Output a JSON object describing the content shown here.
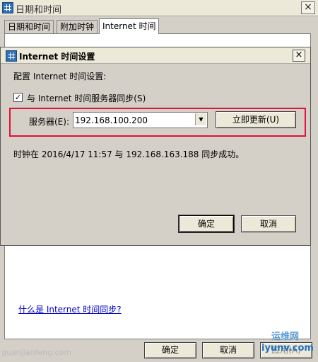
{
  "outer": {
    "title": "日期和时间",
    "tabs": [
      "日期和时间",
      "附加时钟",
      "Internet 时间"
    ],
    "link": "什么是 Internet 时间同步?",
    "buttons": {
      "ok": "确定",
      "cancel": "取消",
      "apply": "应用(A)"
    }
  },
  "dialog": {
    "title": "Internet 时间设置",
    "config_label": "配置 Internet 时间设置:",
    "sync_label": "与 Internet 时间服务器同步(S)",
    "sync_checked": true,
    "server_label": "服务器(E):",
    "server_value": "192.168.100.200",
    "update_button": "立即更新(U)",
    "status": "时钟在 2016/4/17 11:57 与 192.168.163.188 同步成功。",
    "ok": "确定",
    "cancel": "取消"
  },
  "watermark": {
    "left": "guanjianfeng.com",
    "cn": "运维网",
    "en": "iyunv.com"
  },
  "colors": {
    "highlight_border": "#e0113a",
    "link": "#0000cc"
  }
}
